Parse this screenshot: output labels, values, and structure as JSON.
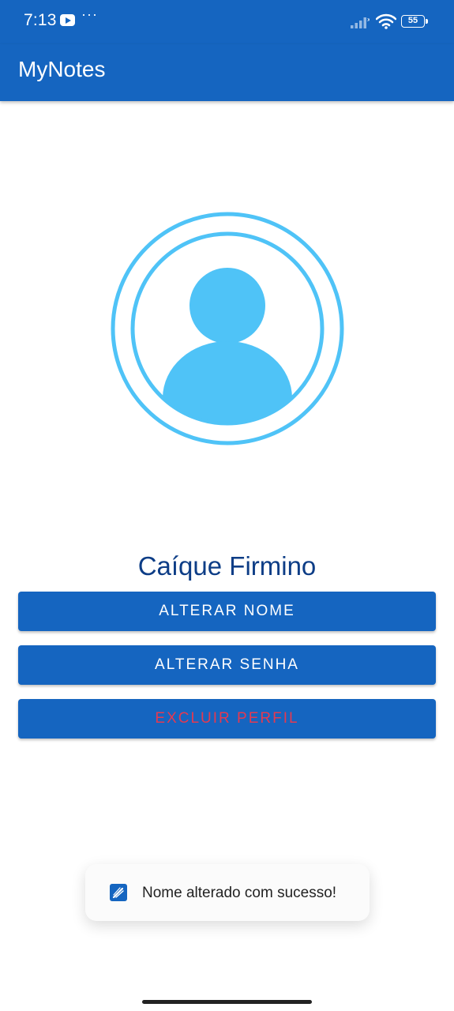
{
  "status_bar": {
    "time": "7:13",
    "battery_level": "55",
    "icons": [
      "youtube-notification-icon",
      "more-notifications-icon",
      "signal-icon",
      "wifi-icon",
      "battery-icon"
    ]
  },
  "app_bar": {
    "title": "MyNotes"
  },
  "profile": {
    "avatar_icon": "user-avatar-icon",
    "name": "Caíque Firmino"
  },
  "actions": {
    "rename_label": "ALTERAR NOME",
    "change_password_label": "ALTERAR SENHA",
    "delete_profile_label": "EXCLUIR PERFIL"
  },
  "toast": {
    "icon": "app-icon",
    "message": "Nome alterado com sucesso!"
  },
  "colors": {
    "primary": "#1565c0",
    "avatar": "#4fc3f7",
    "name_text": "#0d3d86",
    "danger_text": "#e53950",
    "button_text": "#ffffff"
  }
}
